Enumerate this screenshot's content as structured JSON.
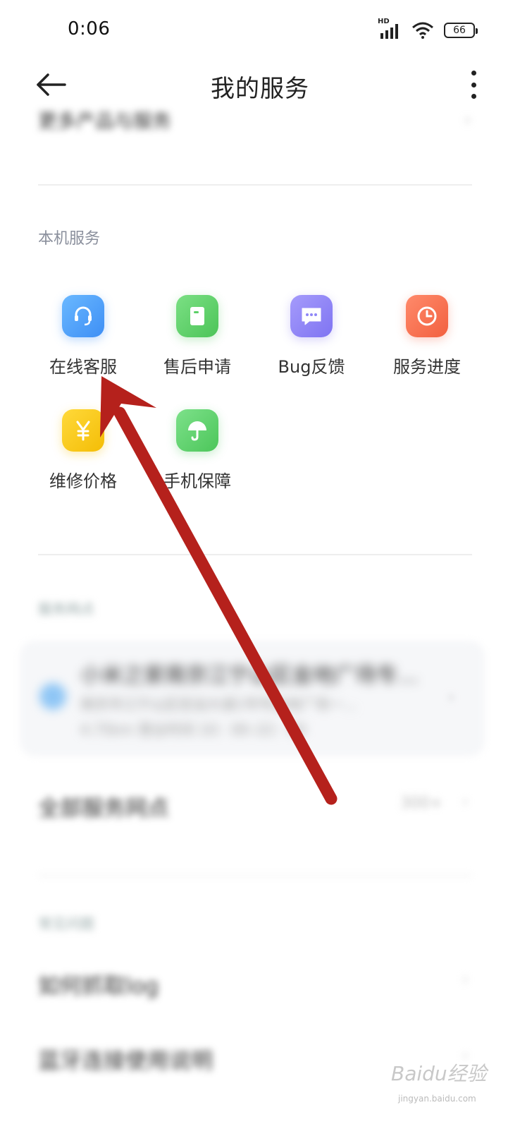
{
  "status_bar": {
    "time": "0:06",
    "network_label": "HD",
    "battery": "66"
  },
  "header": {
    "title": "我的服务"
  },
  "peek_row": {
    "label": "更多产品与服务"
  },
  "section_local": {
    "title": "本机服务"
  },
  "services": [
    {
      "label": "在线客服",
      "color": "#4aa5fb",
      "icon": "headset-icon"
    },
    {
      "label": "售后申请",
      "color": "#5fd46a",
      "icon": "document-icon"
    },
    {
      "label": "Bug反馈",
      "color": "#8f86f7",
      "icon": "chat-bubble-icon"
    },
    {
      "label": "服务进度",
      "color": "#f86e52",
      "icon": "clock-icon"
    },
    {
      "label": "维修价格",
      "color": "#f9c816",
      "icon": "yen-icon"
    },
    {
      "label": "手机保障",
      "color": "#5bd46c",
      "icon": "umbrella-icon"
    }
  ],
  "section_outlets": {
    "title": "服务网点"
  },
  "outlet": {
    "name": "小米之家南京江宁山区金地广场专…",
    "address": "南京市江宁山区宏运大道1号号金地广场一…",
    "hours": "4.75km 营业时间 10：00–22：00"
  },
  "all_outlets": {
    "label": "全部服务网点",
    "count": "300+"
  },
  "section_faq": {
    "title": "常见问题"
  },
  "faq": [
    {
      "label": "如何抓取log"
    },
    {
      "label": "蓝牙连接使用说明"
    }
  ],
  "watermark": {
    "text": "Baidu经验",
    "sub": "jingyan.baidu.com"
  },
  "colors": {
    "annotation_arrow": "#b5211c",
    "divider": "#eeeeee",
    "section_title": "#8a8f9c"
  }
}
